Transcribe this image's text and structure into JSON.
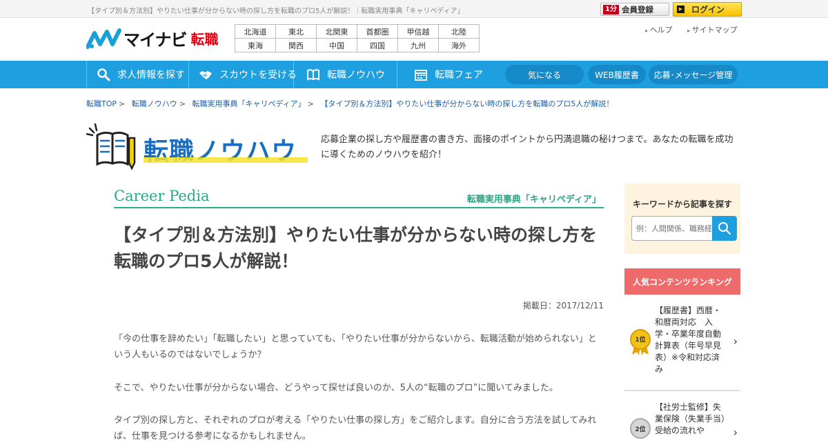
{
  "topbar": {
    "page_title": "【タイプ別＆方法別】やりたい仕事が分からない時の探し方を転職のプロ5人が解説！｜転職実用事典「キャリペディア」",
    "register_badge": "1分",
    "register_label": "会員登録",
    "login_label": "ログイン"
  },
  "logo": {
    "brand": "マイナビ",
    "sub": "転職"
  },
  "regions": [
    [
      "北海道",
      "東北",
      "北関東",
      "首都圏",
      "甲信越",
      "北陸"
    ],
    [
      "東海",
      "関西",
      "中国",
      "四国",
      "九州",
      "海外"
    ]
  ],
  "header_links": [
    "ヘルプ",
    "サイトマップ"
  ],
  "nav": {
    "items": [
      "求人情報を探す",
      "スカウトを受ける",
      "転職ノウハウ",
      "転職フェア"
    ],
    "pills": [
      "気になる",
      "WEB履歴書",
      "応募･メッセージ管理"
    ]
  },
  "breadcrumb": [
    "転職TOP",
    "転職ノウハウ",
    "転職実用事典「キャリペディア」",
    "【タイプ別＆方法別】やりたい仕事が分からない時の探し方を転職のプロ5人が解説！"
  ],
  "hero": {
    "title": "転職ノウハウ",
    "description": "応募企業の探し方や履歴書の書き方、面接のポイントから円満退職の秘けつまで。あなたの転職を成功に導くためのノウハウを紹介！"
  },
  "section": {
    "en": "Career Pedia",
    "jp": "転職実用事典「キャリペディア」"
  },
  "article": {
    "title": "【タイプ別＆方法別】やりたい仕事が分からない時の探し方を転職のプロ5人が解説！",
    "date": "掲載日：2017/12/11",
    "paragraphs": [
      "「今の仕事を辞めたい」「転職したい」と思っていても、「やりたい仕事が分からないから、転職活動が始められない」という人もいるのではないでしょうか？",
      "そこで、やりたい仕事が分からない場合、どうやって探せば良いのか、5人の“転職のプロ”に聞いてみました。",
      "タイプ別の探し方と、それぞれのプロが考える「やりたい仕事の探し方」をご紹介します。自分に合う方法を試してみれば、仕事を見つける参考になるかもしれません。"
    ]
  },
  "sidebar": {
    "search_label": "キーワードから記事を探す",
    "search_placeholder": "例：人間関係、職務経歴書",
    "ranking_title": "人気コンテンツランキング",
    "ranking": [
      {
        "rank": "1位",
        "text": "【履歴書】西暦・和暦両対応　入学・卒業年度自動計算表（年号早見表）※令和対応済み"
      },
      {
        "rank": "2位",
        "text": "【社労士監修】失業保険（失業手当）受給の流れや"
      }
    ]
  },
  "colors": {
    "nav": "#1ea0e0",
    "accent_green": "#2aa884",
    "ranking": "#ef6b6b",
    "brand_red": "#e60012"
  }
}
